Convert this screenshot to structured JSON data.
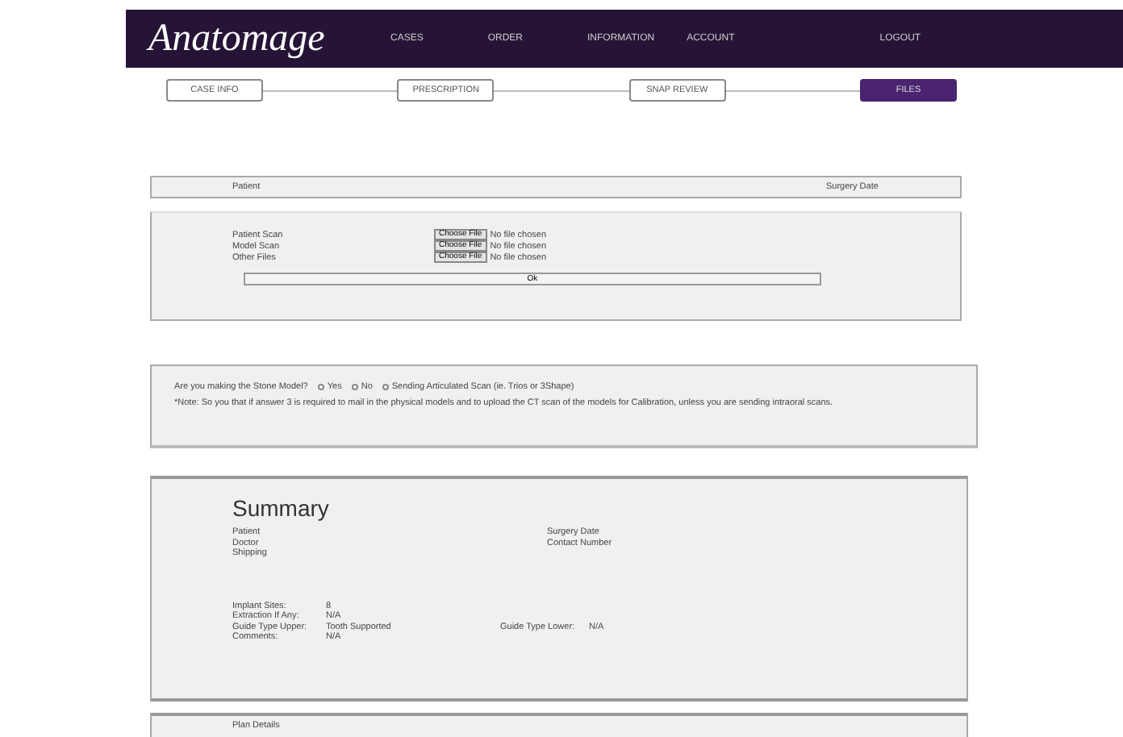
{
  "header": {
    "logo": "Anatomage",
    "nav": [
      {
        "label": "CASES"
      },
      {
        "label": "ORDER"
      },
      {
        "label": "INFORMATION"
      },
      {
        "label": "ACCOUNT"
      },
      {
        "label": "LOGOUT"
      }
    ]
  },
  "steps": [
    {
      "label": "CASE INFO",
      "selected": false
    },
    {
      "label": "PRESCRIPTION",
      "selected": false
    },
    {
      "label": "SNAP REVIEW",
      "selected": false
    },
    {
      "label": "FILES",
      "selected": true
    }
  ],
  "patient_bar": {
    "patient": "Patient",
    "surgery_date": "Surgery Date"
  },
  "uploads": {
    "rows": [
      {
        "label": "Patient Scan",
        "button": "Choose File",
        "status": "No file chosen"
      },
      {
        "label": "Model Scan",
        "button": "Choose File",
        "status": "No file chosen"
      },
      {
        "label": "Other Files",
        "button": "Choose File",
        "status": "No file chosen"
      }
    ],
    "ok_button": "Ok"
  },
  "stone_model": {
    "question": "Are you making the Stone Model?",
    "options": [
      {
        "label": "Yes",
        "selected": false
      },
      {
        "label": "No",
        "selected": false
      },
      {
        "label": "Sending Articulated Scan (ie. Trios or 3Shape)",
        "selected": false
      }
    ],
    "note": "*Note: So you that if answer 3 is required to mail in the physical models and to upload the CT scan of the models for Calibration, unless you are sending intraoral scans."
  },
  "summary": {
    "title": "Summary",
    "left": [
      "Patient",
      "Doctor",
      "Shipping"
    ],
    "right": [
      "Surgery Date",
      "Contact Number"
    ],
    "rows": [
      {
        "label": "Implant Sites:",
        "value": "8"
      },
      {
        "label": "Extraction If Any:",
        "value": "N/A"
      },
      {
        "label": "Guide Type Upper:",
        "value": "Tooth Supported",
        "label_2": "Guide Type Lower:",
        "value_2": "N/A"
      },
      {
        "label": "Comments:",
        "value": "N/A"
      }
    ]
  },
  "next_panel": {
    "title": "Plan Details"
  }
}
